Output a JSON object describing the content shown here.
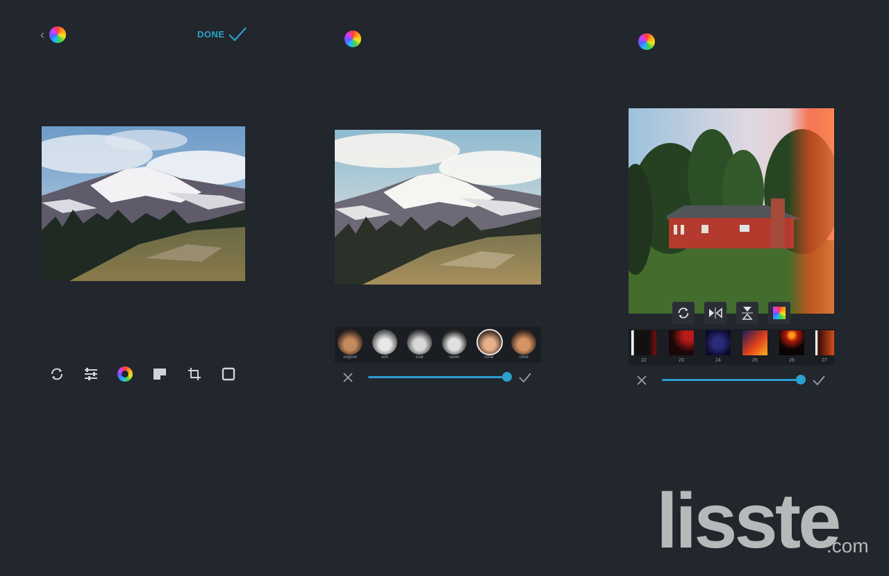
{
  "screen1": {
    "back_glyph": "‹",
    "done_label": "DONE",
    "tools": [
      "rotate-icon",
      "adjust-icon",
      "color-wheel-icon",
      "texture-icon",
      "crop-icon",
      "frame-icon"
    ]
  },
  "screen2": {
    "filters": [
      {
        "label": "original"
      },
      {
        "label": "ash"
      },
      {
        "label": "coal"
      },
      {
        "label": "raven"
      },
      {
        "label": "coral"
      },
      {
        "label": "crest"
      }
    ],
    "slider_value": 1.0
  },
  "screen3": {
    "transform_tools": [
      "rotate-icon",
      "flip-horizontal-icon",
      "flip-vertical-icon",
      "color-square-icon"
    ],
    "textures": [
      {
        "label": "22"
      },
      {
        "label": "23"
      },
      {
        "label": "24"
      },
      {
        "label": "25"
      },
      {
        "label": "26"
      },
      {
        "label": "27"
      }
    ],
    "slider_value": 1.0
  },
  "watermark": {
    "brand": "lisste",
    "suffix": ".com"
  },
  "colors": {
    "background": "#22262d",
    "accent": "#2c9fcf"
  }
}
